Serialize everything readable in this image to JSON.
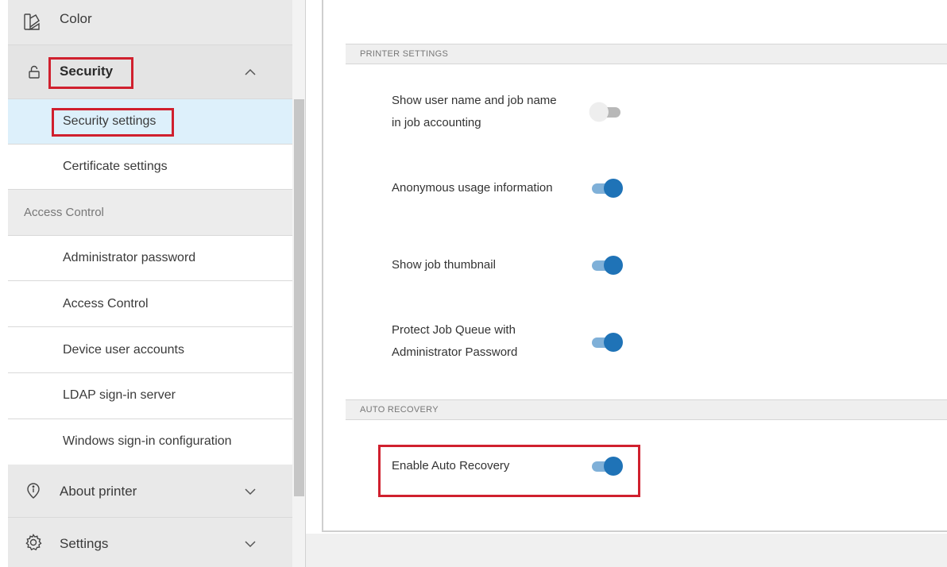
{
  "sidebar": {
    "color_item": {
      "label": "Color",
      "icon": "color-icon"
    },
    "security_item": {
      "label": "Security",
      "icon": "lock-icon",
      "expanded": true
    },
    "security_sub": [
      {
        "label": "Security settings",
        "selected": true
      },
      {
        "label": "Certificate settings"
      }
    ],
    "access_group": {
      "label": "Access Control"
    },
    "access_sub": [
      {
        "label": "Administrator password"
      },
      {
        "label": "Access Control"
      },
      {
        "label": "Device user accounts"
      },
      {
        "label": "LDAP sign-in server"
      },
      {
        "label": "Windows sign-in configuration"
      }
    ],
    "about_item": {
      "label": "About printer",
      "icon": "info-icon"
    },
    "settings_item": {
      "label": "Settings",
      "icon": "gear-icon"
    }
  },
  "main": {
    "printer_settings_header": "PRINTER SETTINGS",
    "printer_settings": [
      {
        "line1": "Show user name and job name",
        "line2": "in job accounting",
        "enabled": false
      },
      {
        "line1": "Anonymous usage information",
        "line2": "",
        "enabled": true
      },
      {
        "line1": "Show job thumbnail",
        "line2": "",
        "enabled": true
      },
      {
        "line1": "Protect Job Queue with",
        "line2": "Administrator Password",
        "enabled": true
      }
    ],
    "auto_recovery_header": "AUTO RECOVERY",
    "auto_recovery": {
      "label": "Enable Auto Recovery",
      "enabled": true
    }
  },
  "colors": {
    "highlight_red": "#d0202e",
    "toggle_on": "#1f73b7",
    "selected_bg": "#ddf0fb"
  }
}
